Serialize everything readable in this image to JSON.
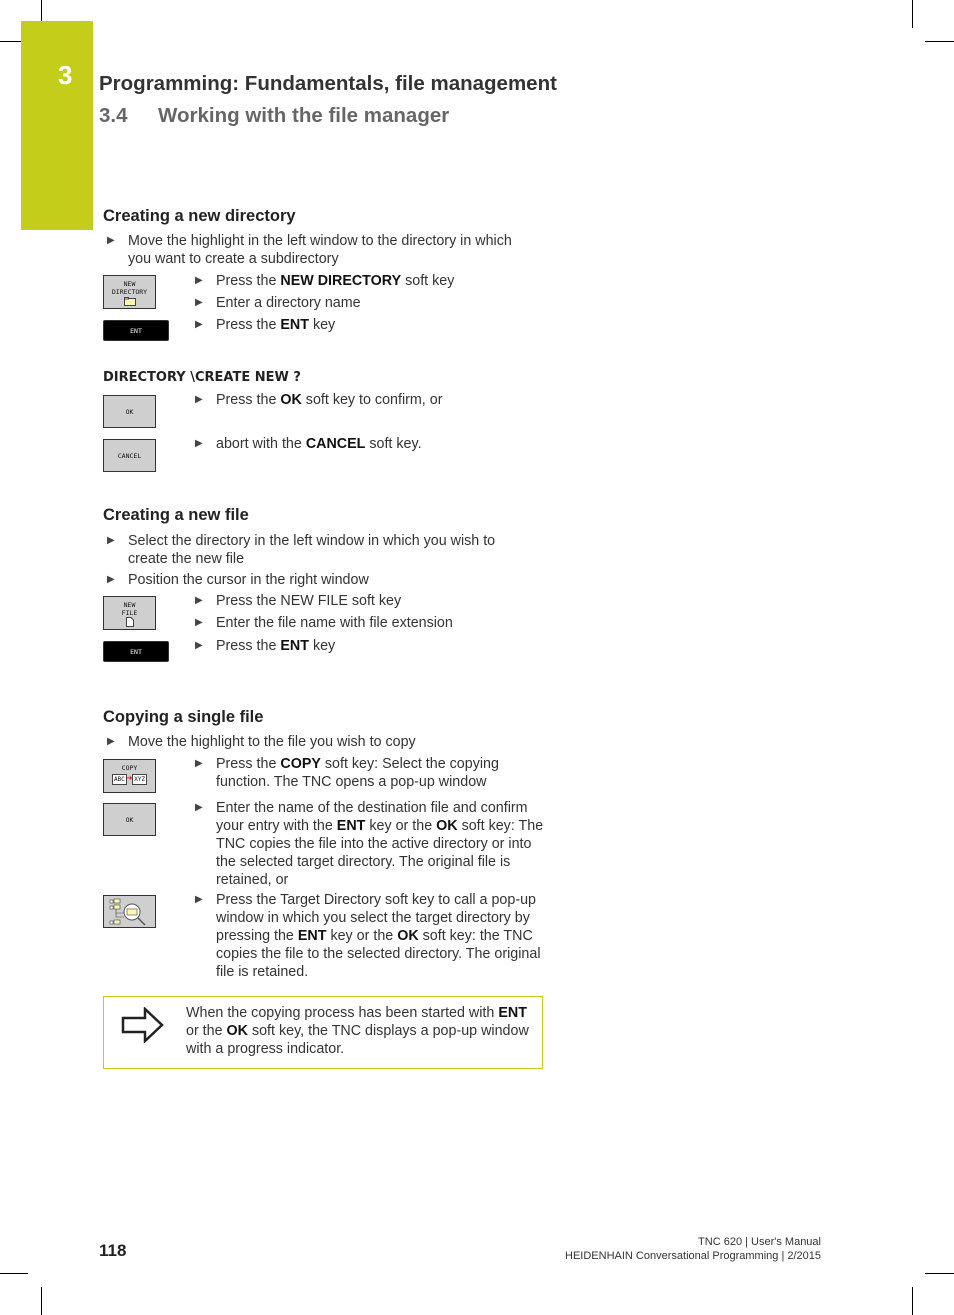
{
  "header": {
    "chapter_number": "3",
    "chapter_title": "Programming: Fundamentals, file management",
    "section_number": "3.4",
    "section_title": "Working with the file manager"
  },
  "sections": {
    "new_directory": {
      "title": "Creating a new directory",
      "intro": "Move the highlight in the left window to the directory in which you want to create a subdirectory",
      "steps": [
        {
          "pre": "Press the ",
          "bold": "NEW DIRECTORY",
          "post": " soft key"
        },
        {
          "pre": "Enter a directory name",
          "bold": "",
          "post": ""
        },
        {
          "pre": "Press the ",
          "bold": "ENT",
          "post": " key"
        }
      ],
      "prompt": "DIRECTORY \\CREATE NEW ?",
      "confirm_steps": [
        {
          "pre": "Press the ",
          "bold": "OK",
          "post": " soft key to confirm, or"
        },
        {
          "pre": "abort with the ",
          "bold": "CANCEL",
          "post": " soft key."
        }
      ],
      "keys": {
        "new_directory": [
          "NEW",
          "DIRECTORY"
        ],
        "ent": "ENT",
        "ok": "OK",
        "cancel": "CANCEL"
      }
    },
    "new_file": {
      "title": "Creating a new file",
      "intro": [
        "Select the directory in the left window in which you wish to create the new file",
        "Position the cursor in the right window"
      ],
      "steps": [
        {
          "pre": "Press the NEW FILE soft key",
          "bold": "",
          "post": ""
        },
        {
          "pre": "Enter the file name with file extension",
          "bold": "",
          "post": ""
        },
        {
          "pre": "Press the ",
          "bold": "ENT",
          "post": " key"
        }
      ],
      "keys": {
        "new_file": [
          "NEW",
          "FILE"
        ],
        "ent": "ENT"
      }
    },
    "copy_file": {
      "title": "Copying a single file",
      "intro": "Move the highlight to the file you wish to copy",
      "step1": {
        "pre": "Press the ",
        "bold": "COPY",
        "post": " soft key: Select the copying function. The TNC opens a pop-up window"
      },
      "step2": {
        "p1": "Enter the name of the destination file and confirm your entry with the ",
        "b1": "ENT",
        "p2": " key or the ",
        "b2": "OK",
        "p3": " soft key: The TNC copies the file into the active directory or into the selected target directory. The original file is retained, or"
      },
      "step3": {
        "p1": "Press the Target Directory soft key to call a pop-up window in which you select the target directory by pressing the ",
        "b1": "ENT",
        "p2": " key or the ",
        "b2": "OK",
        "p3": " soft key: the TNC copies the file to the selected directory. The original file is retained."
      },
      "keys": {
        "copy": "COPY",
        "abc": "ABC",
        "xyz": "XYZ",
        "ok": "OK"
      }
    }
  },
  "note": {
    "icon": "arrow-right-icon",
    "p1": "When the copying process has been started with ",
    "b1": "ENT",
    "p2": " or the ",
    "b2": "OK",
    "p3": " soft key, the TNC displays a pop-up window with a progress indicator."
  },
  "footer": {
    "page_number": "118",
    "line1": "TNC 620 | User's Manual",
    "line2": "HEIDENHAIN Conversational Programming | 2/2015"
  },
  "colors": {
    "accent": "#c3cd1a"
  }
}
